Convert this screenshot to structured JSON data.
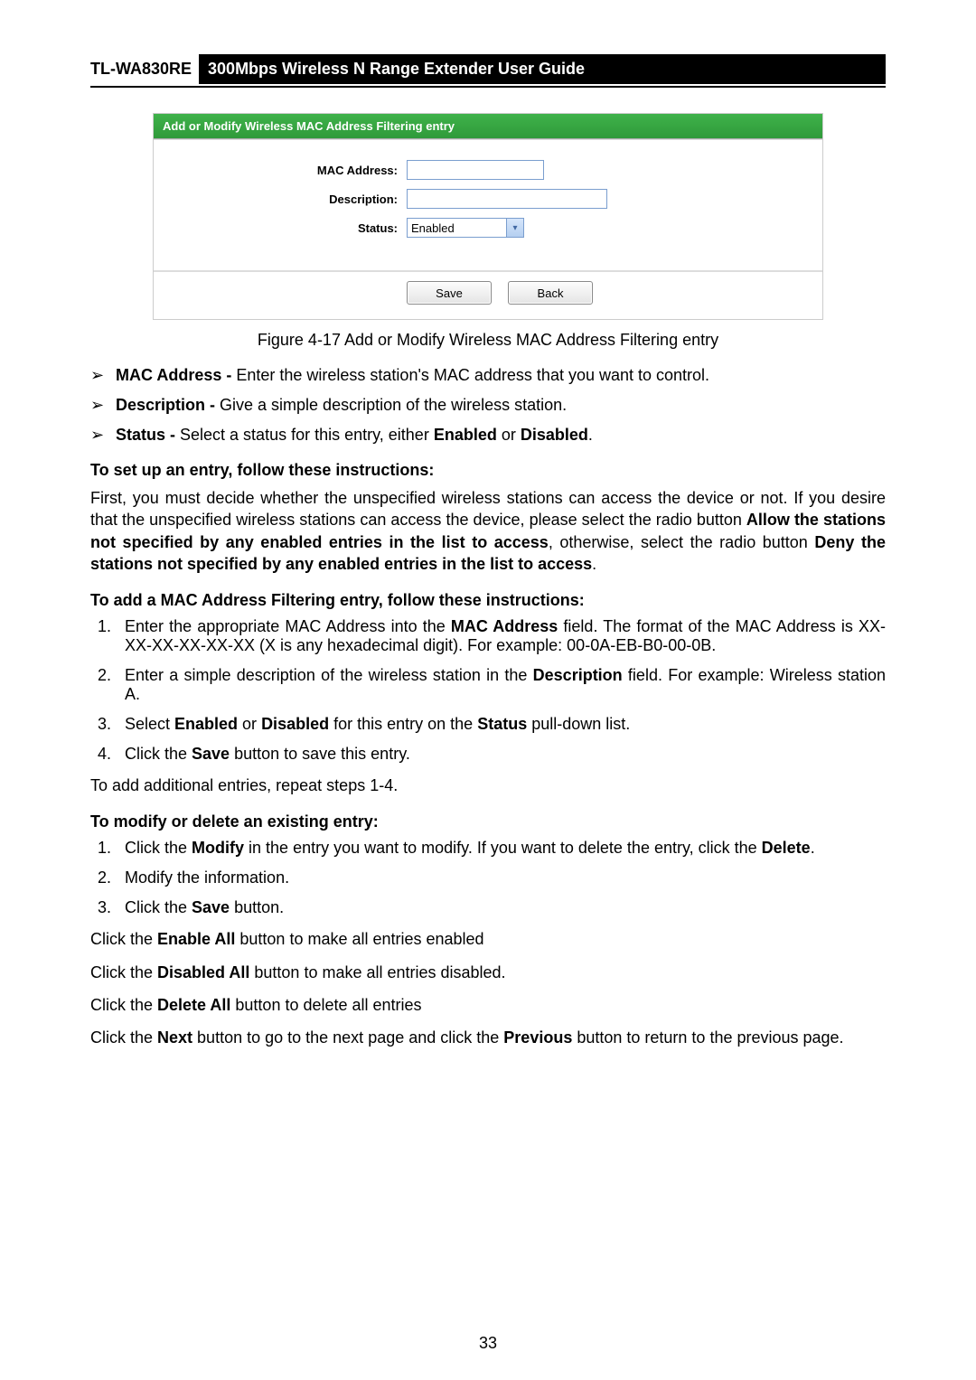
{
  "header": {
    "model": "TL-WA830RE",
    "title": "300Mbps Wireless N Range Extender User Guide"
  },
  "screenshot": {
    "title": "Add or Modify Wireless MAC Address Filtering entry",
    "mac_label": "MAC Address:",
    "desc_label": "Description:",
    "status_label": "Status:",
    "status_value": "Enabled",
    "save_btn": "Save",
    "back_btn": "Back"
  },
  "figure_caption": "Figure 4-17 Add or Modify Wireless MAC Address Filtering entry",
  "bullets": [
    {
      "term": "MAC Address -",
      "text": " Enter the wireless station's MAC address that you want to control."
    },
    {
      "term": "Description -",
      "text": " Give a simple description of the wireless station."
    },
    {
      "term": "Status -",
      "text_pre": " Select a status for this entry, either ",
      "b1": "Enabled",
      "mid": " or ",
      "b2": "Disabled",
      "end": "."
    }
  ],
  "section1": {
    "heading": "To set up an entry, follow these instructions:",
    "para_pre": "First, you must decide whether the unspecified wireless stations can access the device or not. If you desire that the unspecified wireless stations can access the device, please select the radio button ",
    "b1": "Allow the stations not specified by any enabled entries in the list to access",
    "mid": ", otherwise, select the radio button ",
    "b2": "Deny the stations not specified by any enabled entries in the list to access",
    "end": "."
  },
  "section2": {
    "heading": "To add a MAC Address Filtering entry, follow these instructions:",
    "items": [
      {
        "pre": "Enter the appropriate MAC Address into the ",
        "b1": "MAC Address",
        "post": " field. The format of the MAC Address is XX-XX-XX-XX-XX-XX (X is any hexadecimal digit). For example: 00-0A-EB-B0-00-0B."
      },
      {
        "pre": "Enter a simple description of the wireless station in the ",
        "b1": "Description",
        "post": " field. For example: Wireless station A."
      },
      {
        "pre": "Select ",
        "b1": "Enabled",
        "mid": " or ",
        "b2": "Disabled",
        "mid2": " for this entry on the ",
        "b3": "Status",
        "post": " pull-down list."
      },
      {
        "pre": "Click the ",
        "b1": "Save",
        "post": " button to save this entry."
      }
    ],
    "after": "To add additional entries, repeat steps 1-4."
  },
  "section3": {
    "heading": "To modify or delete an existing entry:",
    "items": [
      {
        "pre": "Click the ",
        "b1": "Modify",
        "mid": " in the entry you want to modify. If you want to delete the entry, click the ",
        "b2": "Delete",
        "post": "."
      },
      {
        "pre": "Modify the information."
      },
      {
        "pre": "Click the ",
        "b1": "Save",
        "post": " button."
      }
    ]
  },
  "tail_lines": [
    {
      "pre": "Click the ",
      "b1": "Enable All",
      "post": " button to make all entries enabled"
    },
    {
      "pre": "Click the ",
      "b1": "Disabled All",
      "post": " button to make all entries disabled."
    },
    {
      "pre": "Click the ",
      "b1": "Delete All",
      "post": " button to delete all entries"
    },
    {
      "pre": "Click the ",
      "b1": "Next",
      "mid": " button to go to the next page and click the ",
      "b2": "Previous",
      "post": " button to return to the previous page."
    }
  ],
  "page_number": "33"
}
